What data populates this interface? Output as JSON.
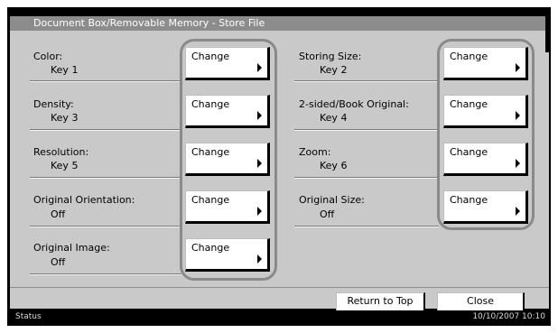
{
  "window": {
    "title": "Document Box/Removable Memory - Store File"
  },
  "settings": {
    "left": [
      {
        "label": "Color:",
        "value": "Key 1",
        "button": "Change"
      },
      {
        "label": "Density:",
        "value": "Key 3",
        "button": "Change"
      },
      {
        "label": "Resolution:",
        "value": "Key 5",
        "button": "Change"
      },
      {
        "label": "Original Orientation:",
        "value": "Off",
        "button": "Change"
      },
      {
        "label": "Original Image:",
        "value": "Off",
        "button": "Change"
      }
    ],
    "right": [
      {
        "label": "Storing Size:",
        "value": "Key 2",
        "button": "Change"
      },
      {
        "label": "2-sided/Book Original:",
        "value": "Key 4",
        "button": "Change"
      },
      {
        "label": "Zoom:",
        "value": "Key 6",
        "button": "Change"
      },
      {
        "label": "Original Size:",
        "value": "Off",
        "button": "Change"
      }
    ]
  },
  "footer": {
    "return_to_top": "Return to Top",
    "close": "Close"
  },
  "status": {
    "label": "Status",
    "datetime": "10/10/2007   10:10"
  },
  "icons": {
    "button_arrow": "right-triangle-icon"
  },
  "colors": {
    "panel": "#c9c9c9",
    "titlebar": "#8c8c8c",
    "highlight": "#8a8a8a"
  }
}
